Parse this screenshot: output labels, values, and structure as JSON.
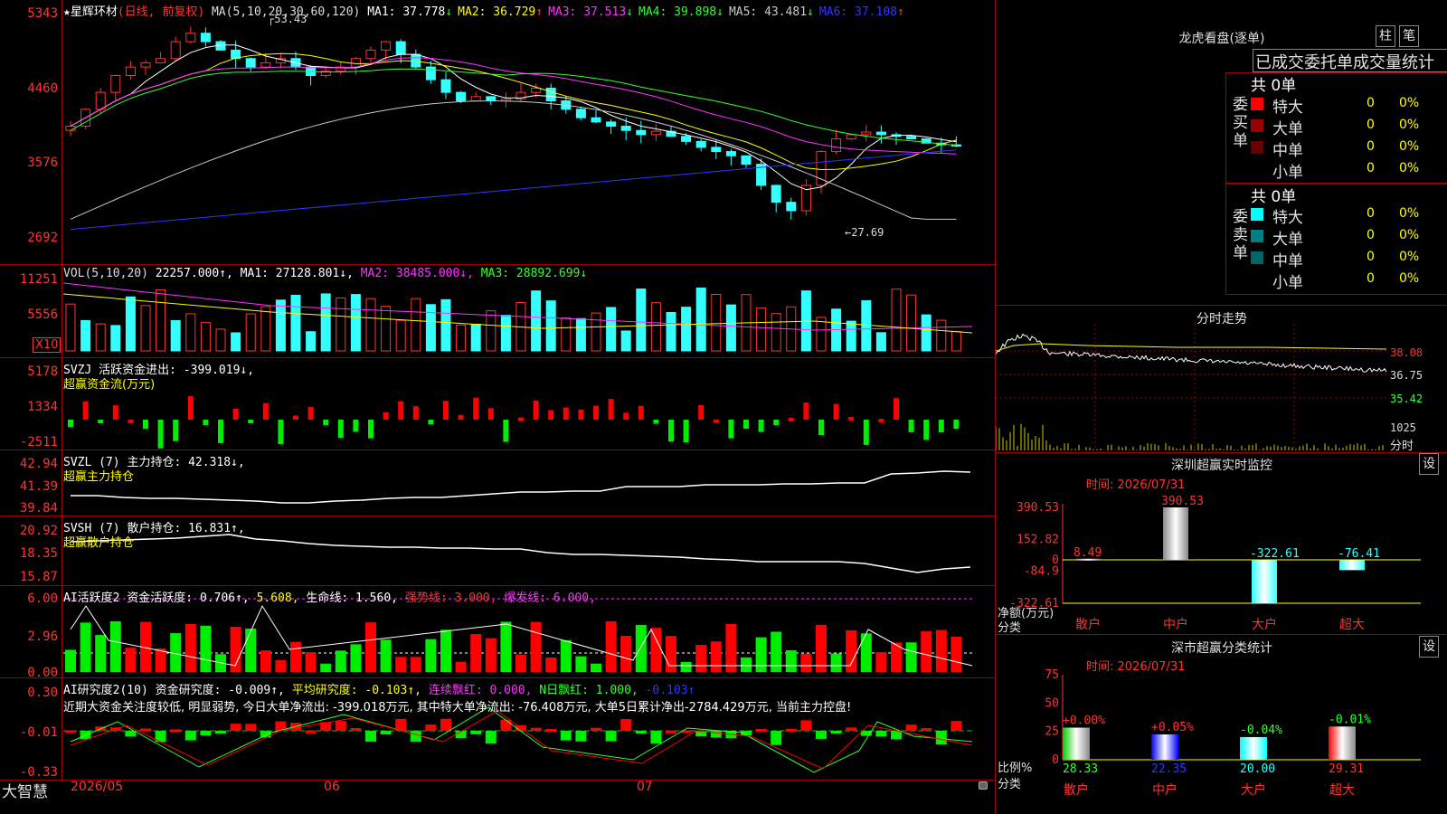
{
  "main_chart": {
    "star": "★",
    "stock_name": "星辉环材",
    "period": "(日线, 前复权)",
    "ma_label": "MA(5,10,20,30,60,120)",
    "ma_values": [
      {
        "name": "MA1:",
        "value": "37.778",
        "arrow": "↓",
        "color": "#ffffff"
      },
      {
        "name": "MA2:",
        "value": "36.729",
        "arrow": "↑",
        "color": "#ffff00"
      },
      {
        "name": "MA3:",
        "value": "37.513",
        "arrow": "↓",
        "color": "#ff33ff"
      },
      {
        "name": "MA4:",
        "value": "39.898",
        "arrow": "↓",
        "color": "#33ff33"
      },
      {
        "name": "MA5:",
        "value": "43.481",
        "arrow": "↓",
        "color": "#c8c8c8"
      },
      {
        "name": "MA6:",
        "value": "37.108",
        "arrow": "↑",
        "color": "#3333ff"
      }
    ],
    "y_ticks": [
      "5343",
      "4460",
      "3576",
      "2692"
    ],
    "high_label": "53.43",
    "low_label": "27.69"
  },
  "volume": {
    "label": "VOL(5,10,20)",
    "value": "22257.000↑,",
    "ma1": "MA1: 27128.801↓,",
    "ma2": "MA2: 38485.000↓,",
    "ma3": "MA3: 28892.699↓",
    "y_ticks": [
      "11251",
      "5556"
    ],
    "unit": "X10"
  },
  "svzj": {
    "label": "SVZJ  活跃资金进出: -399.019↓,",
    "sub": "超赢资金流(万元)",
    "y_ticks": [
      "5178",
      "1334",
      "-2511"
    ]
  },
  "svzl": {
    "label": "SVZL (7) 主力持仓: 42.318↓,",
    "sub": "超赢主力持仓",
    "y_ticks": [
      "42.94",
      "41.39",
      "39.84"
    ]
  },
  "svsh": {
    "label": "SVSH (7) 散户持仓: 16.831↑,",
    "sub": "超赢散户持仓",
    "y_ticks": [
      "20.92",
      "18.35",
      "15.87"
    ]
  },
  "ai_activity": {
    "label1": "AI活跃度2 资金活跃度: 0.706↑,",
    "v2": "5.608,",
    "label3": "生命线: 1.560,",
    "label4": "强势线: 3.000,",
    "label5": "爆发线: 6.000,",
    "y_ticks": [
      "6.00",
      "2.96",
      "0.00"
    ]
  },
  "ai_research": {
    "label1": "AI研究度2(10) 资金研究度: -0.009↑,",
    "label2": "平均研究度: -0.103↑,",
    "label3": "连续飘红: 0.000,",
    "label4": "N日飘红: 1.000,",
    "label5": "-0.103↑",
    "commentary": "近期大资金关注度较低, 明显弱势, 今日大单净流出: -399.018万元, 其中特大单净流出: -76.408万元, 大单5日累计净出-2784.429万元, 当前主力控盘!",
    "y_ticks": [
      "0.30",
      "-0.01",
      "-0.33"
    ]
  },
  "bottom_bar": {
    "brand": "大智慧",
    "dates": [
      "2026/05",
      "06",
      "07"
    ]
  },
  "right_panel": {
    "lhb_title": "龙虎看盘(逐单)",
    "btn_zhu": "柱",
    "btn_bi": "笔",
    "tabs": "已成交委托单成交量统计",
    "buy_label": "委买单",
    "sell_label": "委卖单",
    "buy_total": "共 0单",
    "sell_total": "共 0单",
    "buy_rows": [
      {
        "name": "特大",
        "count": "0",
        "pct": "0%",
        "color": "#ff0000"
      },
      {
        "name": "大单",
        "count": "0",
        "pct": "0%",
        "color": "#990000"
      },
      {
        "name": "中单",
        "count": "0",
        "pct": "0%",
        "color": "#660000"
      },
      {
        "name": "小单",
        "count": "0",
        "pct": "0%",
        "color": "#000000"
      }
    ],
    "sell_rows": [
      {
        "name": "特大",
        "count": "0",
        "pct": "0%",
        "color": "#00ffff"
      },
      {
        "name": "大单",
        "count": "0",
        "pct": "0%",
        "color": "#008080"
      },
      {
        "name": "中单",
        "count": "0",
        "pct": "0%",
        "color": "#006666"
      },
      {
        "name": "小单",
        "count": "0",
        "pct": "0%",
        "color": "#000000"
      }
    ],
    "intraday_title": "分时走势",
    "intraday_y": [
      "38.08",
      "36.75",
      "35.42"
    ],
    "intraday_vol": "1025",
    "intraday_vol_label": "分时",
    "monitor_title": "深圳超赢实时监控",
    "monitor_btn": "设",
    "monitor_time": "时间: 2026/07/31",
    "monitor_y": [
      "390.53",
      "152.82",
      "0",
      "-84.9",
      "-322.61"
    ],
    "monitor_ylabel1": "净额(万元)",
    "monitor_ylabel2": "分类",
    "monitor_bars": [
      {
        "cat": "散户",
        "value": "8.49"
      },
      {
        "cat": "中户",
        "value": "390.53"
      },
      {
        "cat": "大户",
        "value": "-322.61"
      },
      {
        "cat": "超大",
        "value": "-76.41"
      }
    ],
    "stats_title": "深市超赢分类统计",
    "stats_btn": "设",
    "stats_time": "时间: 2026/07/31",
    "stats_y": [
      "75",
      "50",
      "25",
      "0"
    ],
    "stats_ylabel1": "比例%",
    "stats_ylabel2": "分类",
    "stats_bars": [
      {
        "cat": "散户",
        "top": "+0.00%",
        "bottom": "28.33"
      },
      {
        "cat": "中户",
        "top": "+0.05%",
        "bottom": "22.35"
      },
      {
        "cat": "大户",
        "top": "-0.04%",
        "bottom": "20.00"
      },
      {
        "cat": "超大",
        "top": "-0.01%",
        "bottom": "29.31"
      }
    ]
  },
  "chart_data": [
    {
      "type": "bar",
      "title": "深圳超赢实时监控",
      "categories": [
        "散户",
        "中户",
        "大户",
        "超大"
      ],
      "values": [
        8.49,
        390.53,
        -322.61,
        -76.41
      ],
      "ylabel": "净额(万元)",
      "ylim": [
        -322.61,
        390.53
      ]
    },
    {
      "type": "bar",
      "title": "深市超赢分类统计",
      "categories": [
        "散户",
        "中户",
        "大户",
        "超大"
      ],
      "values": [
        28.33,
        22.35,
        20.0,
        29.31
      ],
      "changes": [
        "+0.00%",
        "+0.05%",
        "-0.04%",
        "-0.01%"
      ],
      "ylabel": "比例%",
      "ylim": [
        0,
        75
      ]
    }
  ]
}
